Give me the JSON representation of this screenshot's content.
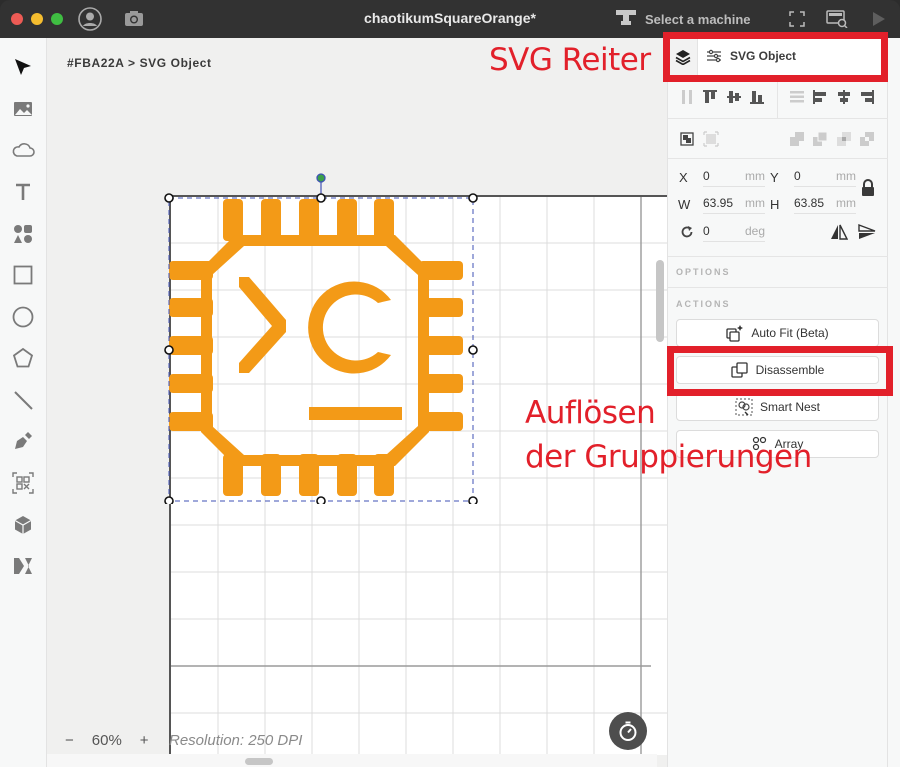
{
  "window": {
    "title": "chaotikumSquareOrange*",
    "machine_select_label": "Select a machine"
  },
  "toolbar_left": {
    "tools": [
      {
        "name": "select",
        "icon": "cursor-arrow-icon"
      },
      {
        "name": "image",
        "icon": "image-icon"
      },
      {
        "name": "cloud",
        "icon": "cloud-icon"
      },
      {
        "name": "text",
        "icon": "text-icon"
      },
      {
        "name": "shapes",
        "icon": "shapes-icon"
      },
      {
        "name": "rectangle",
        "icon": "rectangle-icon"
      },
      {
        "name": "ellipse",
        "icon": "circle-icon"
      },
      {
        "name": "polygon",
        "icon": "pentagon-icon"
      },
      {
        "name": "line",
        "icon": "line-icon"
      },
      {
        "name": "pen",
        "icon": "pen-icon"
      },
      {
        "name": "qr-code",
        "icon": "qr-code-icon"
      },
      {
        "name": "3d-object",
        "icon": "cube-icon"
      },
      {
        "name": "dx",
        "icon": "dx-icon"
      }
    ]
  },
  "canvas": {
    "breadcrumb": "#FBA22A > SVG Object",
    "zoom_minus": "−",
    "zoom_level": "60%",
    "zoom_plus": "+",
    "resolution": "Resolution: 250 DPI",
    "object_color": "#F39A17"
  },
  "panel": {
    "tab_label": "SVG Object",
    "fields": {
      "x_label": "X",
      "x_value": "0",
      "x_unit": "mm",
      "y_label": "Y",
      "y_value": "0",
      "y_unit": "mm",
      "w_label": "W",
      "w_value": "63.95",
      "w_unit": "mm",
      "h_label": "H",
      "h_value": "63.85",
      "h_unit": "mm",
      "rotation_value": "0",
      "rotation_unit": "deg"
    },
    "options_heading": "OPTIONS",
    "actions_heading": "ACTIONS",
    "actions": [
      {
        "label": "Auto Fit (Beta)",
        "icon": "auto-fit-icon"
      },
      {
        "label": "Disassemble",
        "icon": "disassemble-icon"
      },
      {
        "label": "Smart Nest",
        "icon": "smart-nest-icon"
      },
      {
        "label": "Array",
        "icon": "array-icon"
      }
    ]
  },
  "annotations": {
    "svg_tab": "SVG Reiter",
    "disassemble_line1": "Auflösen",
    "disassemble_line2": "der Gruppierungen",
    "highlight_color": "#E2202A"
  }
}
